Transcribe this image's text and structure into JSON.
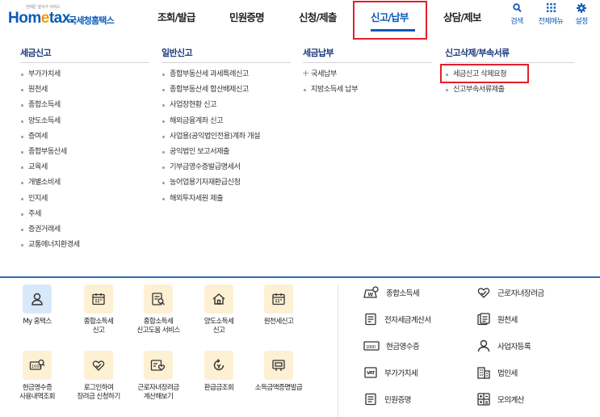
{
  "header": {
    "logo": {
      "slogan": "언제든 앞서가 서비스",
      "brand_main": "Hom",
      "brand_e": "e",
      "brand_tail": "tax.",
      "brand_kr": "국세청홈택스"
    },
    "nav": [
      {
        "label": "조회/발급"
      },
      {
        "label": "민원증명"
      },
      {
        "label": "신청/제출"
      },
      {
        "label": "신고/납부"
      },
      {
        "label": "상담/제보"
      }
    ],
    "active_nav": "신고/납부",
    "utils": [
      {
        "label": "검색",
        "icon": "search-icon"
      },
      {
        "label": "전체메뉴",
        "icon": "grid-menu-icon"
      },
      {
        "label": "설정",
        "icon": "gear-icon"
      }
    ]
  },
  "menu": {
    "columns": [
      {
        "title": "세금신고",
        "items": [
          "부가가치세",
          "원천세",
          "종합소득세",
          "양도소득세",
          "증여세",
          "종합부동산세",
          "교육세",
          "개별소비세",
          "인지세",
          "주세",
          "증권거래세",
          "교통에너지환경세"
        ]
      },
      {
        "title": "일반신고",
        "items": [
          "종합부동산세 과세특례신고",
          "종합부동산세 합산배제신고",
          "사업장현황 신고",
          "해외금융계좌 신고",
          "사업용(공익법인전용)계좌 개설",
          "공익법인 보고서제출",
          "기부금영수증발급명세서",
          "농어업용기자재환급신청",
          "해외투자세원 제출"
        ]
      },
      {
        "title": "세금납부",
        "items": [
          "국세납부",
          "지방소득세 납부"
        ]
      },
      {
        "title": "신고삭제/부속서류",
        "items": [
          "세금신고 삭제요청",
          "신고부속서류제출"
        ]
      }
    ]
  },
  "quick_tiles": [
    {
      "label": "My 홈택스",
      "icon": "person-icon"
    },
    {
      "label": "종합소득세\n신고",
      "icon": "calendar-icon"
    },
    {
      "label": "종합소득세\n신고도움 서비스",
      "icon": "document-search-icon"
    },
    {
      "label": "양도소득세\n신고",
      "icon": "house-icon"
    },
    {
      "label": "원천세신고",
      "icon": "calendar-icon"
    },
    {
      "label": "현금영수증\n사용내역조회",
      "icon": "receipt-search-icon"
    },
    {
      "label": "로그인하여\n장려금 신청하기",
      "icon": "heart-hand-icon"
    },
    {
      "label": "근로자녀장려금\n계산해보기",
      "icon": "heart-document-icon"
    },
    {
      "label": "환급금조회",
      "icon": "refund-icon"
    },
    {
      "label": "소득금액증명발급",
      "icon": "certificate-icon"
    }
  ],
  "quick_links": [
    {
      "label": "종합소득세",
      "icon": "tax-bag-icon"
    },
    {
      "label": "근로자녀장려금",
      "icon": "heart-hand-icon"
    },
    {
      "label": "전자세금계산서",
      "icon": "invoice-icon"
    },
    {
      "label": "원천세",
      "icon": "tax-document-icon"
    },
    {
      "label": "현금영수증",
      "icon": "cash-receipt-icon"
    },
    {
      "label": "사업자등록",
      "icon": "person-outline-icon"
    },
    {
      "label": "부가가치세",
      "icon": "vat-icon"
    },
    {
      "label": "법인세",
      "icon": "building-icon"
    },
    {
      "label": "민원증명",
      "icon": "certificate-doc-icon"
    },
    {
      "label": "모의계산",
      "icon": "calculator-icon"
    }
  ],
  "colors": {
    "brand": "#0a5bb7",
    "accent": "#f39800",
    "highlight": "#e2202b",
    "tile_bg": "#fdf0d3",
    "tile_bg_blue": "#d7e8fb"
  }
}
